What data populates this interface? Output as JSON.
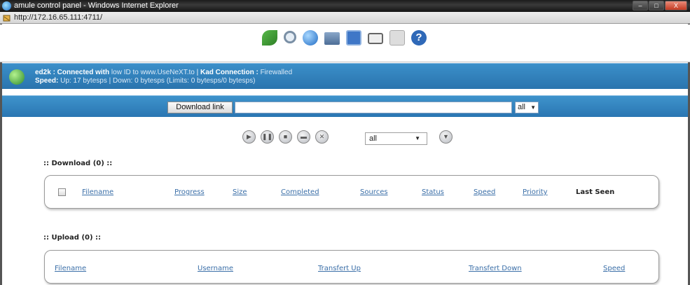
{
  "window": {
    "title": "amule control panel - Windows Internet Explorer",
    "url": "http://172.16.65.111:4711/",
    "buttons": {
      "minimize": "–",
      "maximize": "□",
      "close": "X"
    }
  },
  "toolbar": {
    "icons": [
      "transfer-icon",
      "search-icon",
      "servers-globe-icon",
      "shared-files-folder-icon",
      "statistics-icon",
      "preferences-icon",
      "log-icon",
      "help-icon"
    ],
    "help_glyph": "?"
  },
  "status": {
    "ed2k_label": "ed2k : Connected with",
    "ed2k_value": "low ID to www.UseNeXT.to",
    "separator": "|",
    "kad_label": "Kad Connection :",
    "kad_value": "Firewalled",
    "speed_label": "Speed:",
    "speed_value": "Up: 17 bytesps | Down: 0 bytesps (Limits: 0 bytesps/0 bytesps)"
  },
  "download_link": {
    "button_label": "Download link",
    "input_value": "",
    "category_value": "all"
  },
  "controls": {
    "buttons": [
      "resume-icon",
      "pause-icon",
      "stop-icon",
      "priority-down-icon",
      "cancel-icon"
    ],
    "category_filter": "all"
  },
  "download_section": {
    "title": ":: Download  (0) ::",
    "columns": [
      "Filename",
      "Progress",
      "Size",
      "Completed",
      "Sources",
      "Status",
      "Speed",
      "Priority",
      "Last Seen"
    ]
  },
  "upload_section": {
    "title": ":: Upload  (0) ::",
    "columns": [
      "Filename",
      "Username",
      "Transfert Up",
      "Transfert Down",
      "Speed"
    ]
  }
}
